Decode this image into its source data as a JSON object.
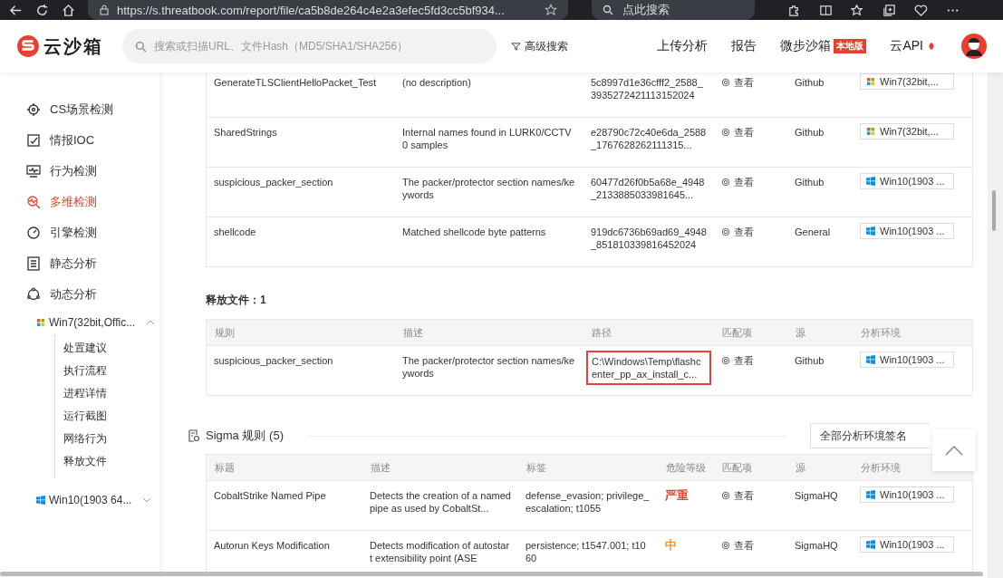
{
  "browser": {
    "url": "https://s.threatbook.com/report/file/ca5b8de264c4e2a3efec5fd3cc5bf934...",
    "search_placeholder": "点此搜索"
  },
  "header": {
    "logo": "云沙箱",
    "search_placeholder": "搜索或扫描URL、文件Hash（MD5/SHA1/SHA256）",
    "advanced": "高级搜索",
    "nav": [
      {
        "label": "上传分析"
      },
      {
        "label": "报告"
      },
      {
        "label": "微步沙箱",
        "badge": "本地版"
      },
      {
        "label": "云API"
      }
    ]
  },
  "sidebar": {
    "items": [
      {
        "label": "CS场景检测",
        "selected": false
      },
      {
        "label": "情报IOC",
        "selected": false
      },
      {
        "label": "行为检测",
        "selected": false
      },
      {
        "label": "多维检测",
        "selected": true
      },
      {
        "label": "引擎检测",
        "selected": false
      },
      {
        "label": "静态分析",
        "selected": false
      },
      {
        "label": "动态分析",
        "selected": false
      }
    ],
    "envs": [
      {
        "label": "Win7(32bit,Offic...",
        "kind": "win7",
        "expanded": true,
        "children": [
          {
            "label": "处置建议"
          },
          {
            "label": "执行流程"
          },
          {
            "label": "进程详情"
          },
          {
            "label": "运行截图"
          },
          {
            "label": "网络行为"
          },
          {
            "label": "释放文件"
          }
        ]
      },
      {
        "label": "Win10(1903 64...",
        "kind": "win10",
        "expanded": false
      }
    ]
  },
  "yara_table": {
    "rows": [
      {
        "rule": "GenerateTLSClientHelloPacket_Test",
        "description": "(no description)",
        "path": "5c8997d1e36cfff2_2588_3935272421113152024",
        "match": "查看",
        "source": "Github",
        "env": "Win7(32bit,...",
        "kind": "win7"
      },
      {
        "rule": "SharedStrings",
        "description": "Internal names found in LURK0/CCTV0 samples",
        "path": "e28790c72c40e6da_2588_1767628262111315...",
        "match": "查看",
        "source": "Github",
        "env": "Win7(32bit,...",
        "kind": "win7"
      },
      {
        "rule": "suspicious_packer_section",
        "description": "The packer/protector section names/keywords",
        "path": "60477d26f0b5a68e_4948_2133885033981645...",
        "match": "查看",
        "source": "Github",
        "env": "Win10(1903 ...",
        "kind": "win10"
      },
      {
        "rule": "shellcode",
        "description": "Matched shellcode byte patterns",
        "path": "919dc6736b69ad69_4948_851810339816452024",
        "match": "查看",
        "source": "General",
        "env": "Win10(1903 ...",
        "kind": "win10"
      }
    ]
  },
  "released_files": {
    "title": "释放文件：1",
    "columns": [
      "规则",
      "描述",
      "路径",
      "匹配项",
      "源",
      "分析环境"
    ],
    "rows": [
      {
        "rule": "suspicious_packer_section",
        "description": "The packer/protector section names/keywords",
        "path": "C:\\Windows\\Temp\\flashcenter_pp_ax_install_c...",
        "highlighted": true,
        "match": "查看",
        "source": "Github",
        "env": "Win10(1903 ...",
        "kind": "win10"
      }
    ]
  },
  "sigma": {
    "title": "Sigma 规则 (5)",
    "filter": "全部分析环境签名",
    "columns": [
      "标题",
      "描述",
      "标签",
      "危险等级",
      "匹配项",
      "源",
      "分析环境"
    ],
    "rows": [
      {
        "title": "CobaltStrike Named Pipe",
        "description": "Detects the creation of a named pipe as used by CobaltSt...",
        "tags": "defense_evasion; privilege_escalation; t1055",
        "severity": "严重",
        "color": "#e8402f",
        "match": "查看",
        "source": "SigmaHQ",
        "env": "Win10(1903 ...",
        "kind": "win10"
      },
      {
        "title": "Autorun Keys Modification",
        "description": "Detects modification of autostart extensibility point (ASE",
        "tags": "persistence; t1547.001; t1060",
        "severity": "中",
        "color": "#f0913a",
        "match": "查看",
        "source": "SigmaHQ",
        "env": "Win10(1903 ...",
        "kind": "win10"
      }
    ]
  }
}
